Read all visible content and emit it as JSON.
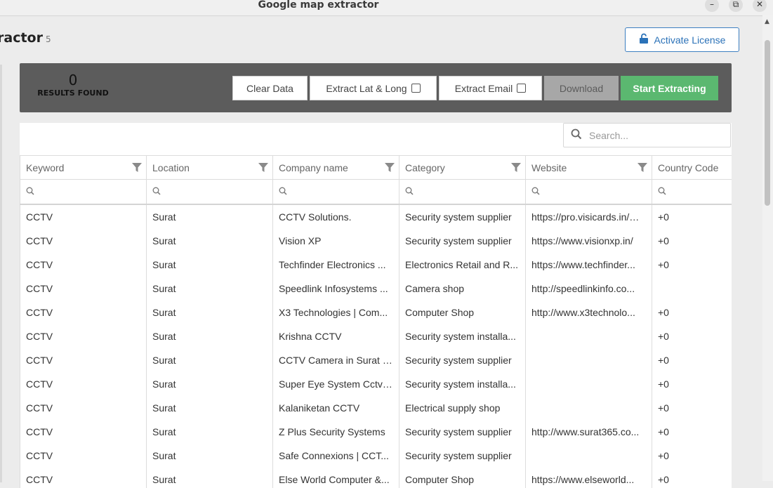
{
  "window": {
    "title": "Google map extractor",
    "min_glyph": "–",
    "max_glyph": "⧉",
    "close_glyph": "✕"
  },
  "app": {
    "title": "ractor",
    "version": "5"
  },
  "license_button": {
    "label": "Activate License",
    "icon": "unlock-icon"
  },
  "toolbar": {
    "results_count": "0",
    "results_label": "RESULTS FOUND",
    "clear_label": "Clear Data",
    "latlong_label": "Extract Lat & Long",
    "latlong_checked": false,
    "email_label": "Extract Email",
    "email_checked": false,
    "download_label": "Download",
    "start_label": "Start Extracting"
  },
  "search": {
    "placeholder": "Search..."
  },
  "columns": [
    "Keyword",
    "Location",
    "Company name",
    "Category",
    "Website",
    "Country Code"
  ],
  "rows": [
    [
      "CCTV",
      "Surat",
      "CCTV Solutions.",
      "Security system supplier",
      "https://pro.visicards.in/…",
      "+0"
    ],
    [
      "CCTV",
      "Surat",
      "Vision XP",
      "Security system supplier",
      "https://www.visionxp.in/",
      "+0"
    ],
    [
      "CCTV",
      "Surat",
      "Techfinder Electronics ...",
      "Electronics Retail and R...",
      "https://www.techfinder...",
      "+0"
    ],
    [
      "CCTV",
      "Surat",
      "Speedlink Infosystems ...",
      "Camera shop",
      "http://speedlinkinfo.co...",
      ""
    ],
    [
      "CCTV",
      "Surat",
      "X3 Technologies | Com...",
      "Computer Shop",
      "http://www.x3technolo...",
      "+0"
    ],
    [
      "CCTV",
      "Surat",
      "Krishna CCTV",
      "Security system installa...",
      "",
      "+0"
    ],
    [
      "CCTV",
      "Surat",
      "CCTV Camera in Surat -...",
      "Security system supplier",
      "",
      "+0"
    ],
    [
      "CCTV",
      "Surat",
      "Super Eye System Cctv ...",
      "Security system installa...",
      "",
      "+0"
    ],
    [
      "CCTV",
      "Surat",
      "Kalaniketan CCTV",
      "Electrical supply shop",
      "",
      "+0"
    ],
    [
      "CCTV",
      "Surat",
      "Z Plus Security Systems",
      "Security system supplier",
      "http://www.surat365.co...",
      "+0"
    ],
    [
      "CCTV",
      "Surat",
      "Safe Connexions | CCT...",
      "Security system supplier",
      "",
      "+0"
    ],
    [
      "CCTV",
      "Surat",
      "Else World Computer &...",
      "Computer Shop",
      "https://www.elseworld...",
      "+0"
    ]
  ],
  "colors": {
    "toolbar_bg": "#5c5c5c",
    "start_bg": "#5bb870",
    "download_bg": "#a7a7a7",
    "license_border": "#3d7fc1"
  }
}
